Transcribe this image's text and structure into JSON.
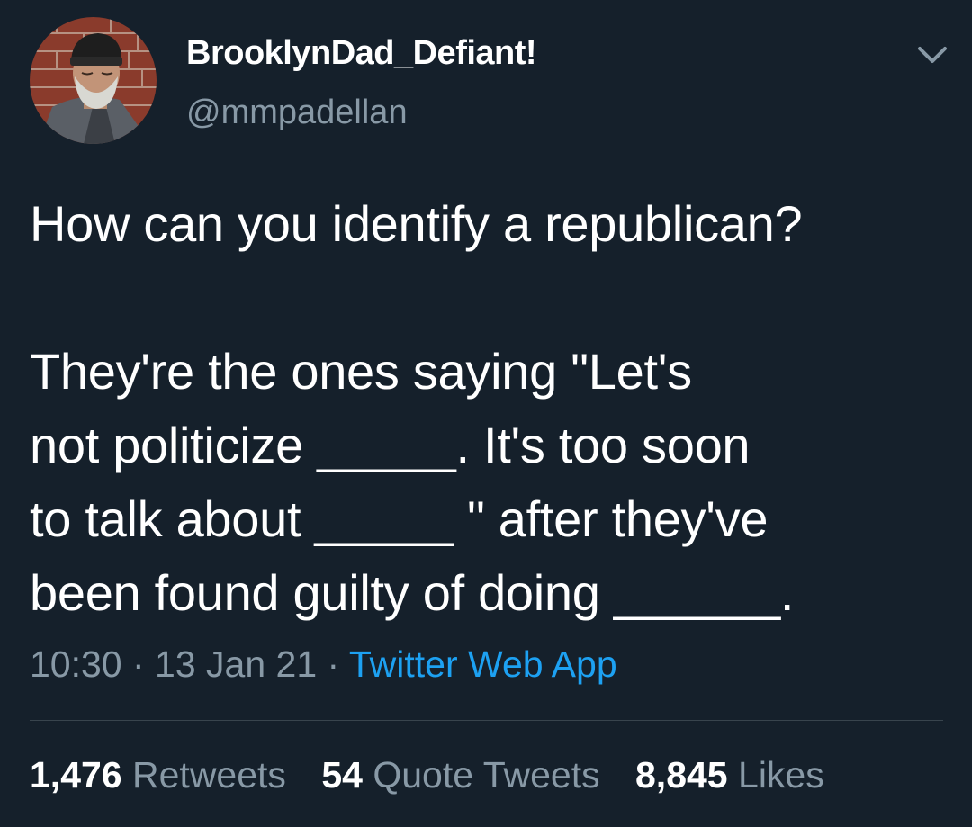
{
  "author": {
    "display_name": "BrooklynDad_Defiant!",
    "handle": "@mmpadellan",
    "avatar_icon": "profile-photo"
  },
  "tweet": {
    "text": "How can you identify a republican?\n\nThey're the ones saying \"Let's\nnot politicize _____. It's too soon\nto talk about _____ \" after they've\nbeen found guilty of doing ______."
  },
  "meta": {
    "time": "10:30",
    "sep1": " · ",
    "date": "13 Jan 21",
    "sep2": " · ",
    "source": "Twitter Web App"
  },
  "stats": {
    "retweets_count": "1,476",
    "retweets_label": "Retweets",
    "quote_count": "54",
    "quote_label": "Quote Tweets",
    "likes_count": "8,845",
    "likes_label": "Likes"
  },
  "colors": {
    "background": "#15202b",
    "text": "#ffffff",
    "secondary": "#8899a6",
    "link": "#1da1f2",
    "divider": "#38444d"
  },
  "icons": {
    "more": "chevron-down-icon"
  }
}
